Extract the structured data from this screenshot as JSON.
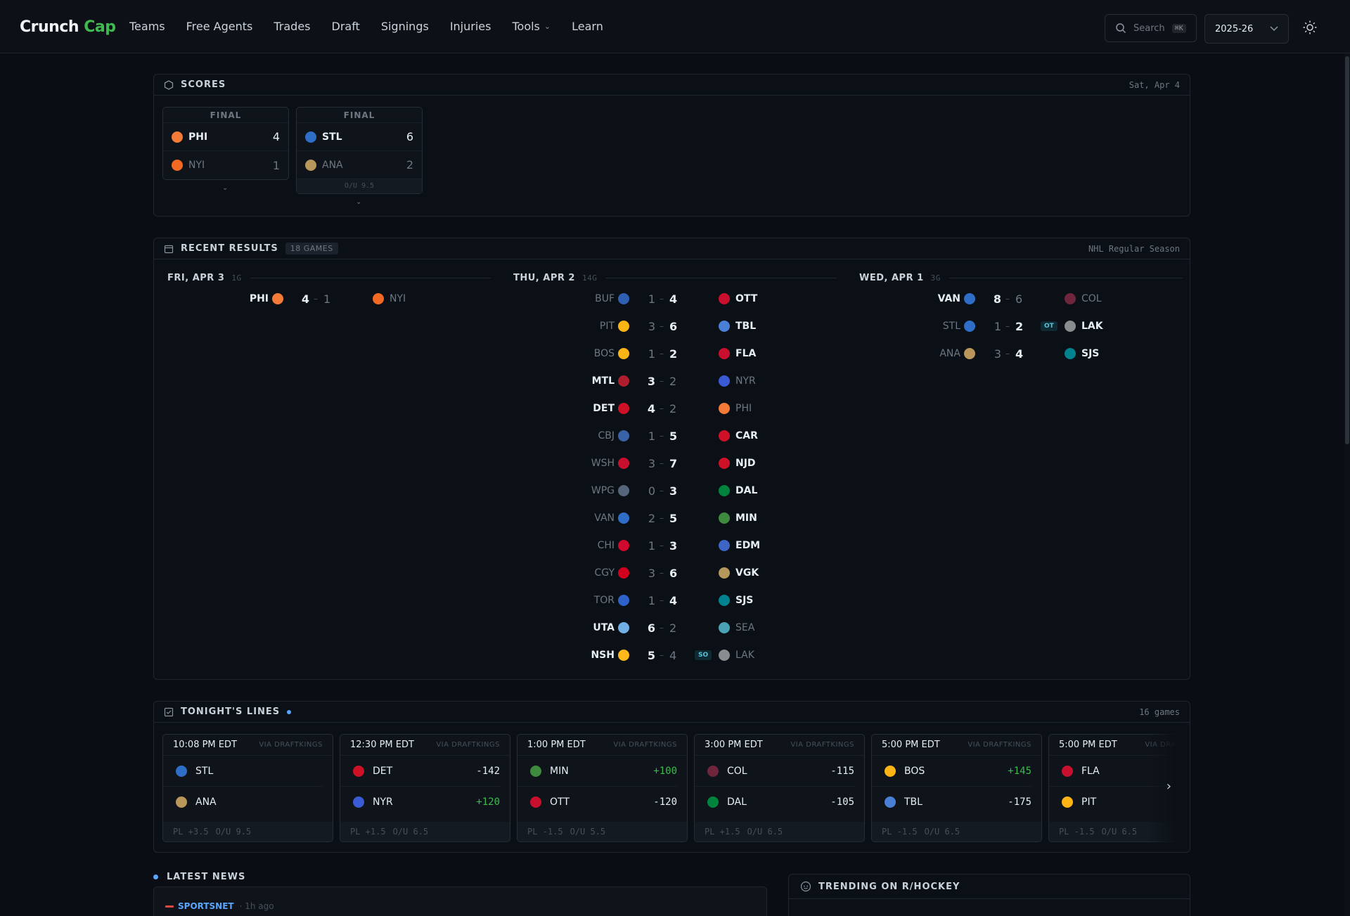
{
  "nav": {
    "logo_main": "Crunch",
    "logo_accent": "Cap",
    "links": [
      "Teams",
      "Free Agents",
      "Trades",
      "Draft",
      "Signings",
      "Injuries",
      "Tools",
      "Learn"
    ],
    "search_placeholder": "Search",
    "search_kbd": "⌘K",
    "season": "2025-26"
  },
  "colors": {
    "accent": "#3fb950",
    "link": "#58a6ff",
    "badge": "#58c4dc"
  },
  "scores": {
    "title": "SCORES",
    "date": "Sat, Apr 4",
    "cards": [
      {
        "status": "FINAL",
        "rows": [
          {
            "team": "PHI",
            "score": "4",
            "win": true
          },
          {
            "team": "NYI",
            "score": "1",
            "win": false
          }
        ],
        "ou": ""
      },
      {
        "status": "FINAL",
        "rows": [
          {
            "team": "STL",
            "score": "6",
            "win": true
          },
          {
            "team": "ANA",
            "score": "2",
            "win": false
          }
        ],
        "ou": "O/U 9.5"
      }
    ]
  },
  "recent": {
    "title": "RECENT RESULTS",
    "count": "18 GAMES",
    "season_label": "NHL Regular Season",
    "days": [
      {
        "label": "FRI, APR 3",
        "count": "1G",
        "games": [
          {
            "away": "PHI",
            "as": "4",
            "hs": "1",
            "home": "NYI",
            "tag": "",
            "aw": true
          }
        ]
      },
      {
        "label": "THU, APR 2",
        "count": "14G",
        "games": [
          {
            "away": "BUF",
            "as": "1",
            "hs": "4",
            "home": "OTT",
            "tag": "",
            "aw": false
          },
          {
            "away": "PIT",
            "as": "3",
            "hs": "6",
            "home": "TBL",
            "tag": "",
            "aw": false
          },
          {
            "away": "BOS",
            "as": "1",
            "hs": "2",
            "home": "FLA",
            "tag": "",
            "aw": false
          },
          {
            "away": "MTL",
            "as": "3",
            "hs": "2",
            "home": "NYR",
            "tag": "",
            "aw": true
          },
          {
            "away": "DET",
            "as": "4",
            "hs": "2",
            "home": "PHI",
            "tag": "",
            "aw": true
          },
          {
            "away": "CBJ",
            "as": "1",
            "hs": "5",
            "home": "CAR",
            "tag": "",
            "aw": false
          },
          {
            "away": "WSH",
            "as": "3",
            "hs": "7",
            "home": "NJD",
            "tag": "",
            "aw": false
          },
          {
            "away": "WPG",
            "as": "0",
            "hs": "3",
            "home": "DAL",
            "tag": "",
            "aw": false
          },
          {
            "away": "VAN",
            "as": "2",
            "hs": "5",
            "home": "MIN",
            "tag": "",
            "aw": false
          },
          {
            "away": "CHI",
            "as": "1",
            "hs": "3",
            "home": "EDM",
            "tag": "",
            "aw": false
          },
          {
            "away": "CGY",
            "as": "3",
            "hs": "6",
            "home": "VGK",
            "tag": "",
            "aw": false
          },
          {
            "away": "TOR",
            "as": "1",
            "hs": "4",
            "home": "SJS",
            "tag": "",
            "aw": false
          },
          {
            "away": "UTA",
            "as": "6",
            "hs": "2",
            "home": "SEA",
            "tag": "",
            "aw": true
          },
          {
            "away": "NSH",
            "as": "5",
            "hs": "4",
            "home": "LAK",
            "tag": "SO",
            "aw": true
          }
        ]
      },
      {
        "label": "WED, APR 1",
        "count": "3G",
        "games": [
          {
            "away": "VAN",
            "as": "8",
            "hs": "6",
            "home": "COL",
            "tag": "",
            "aw": true
          },
          {
            "away": "STL",
            "as": "1",
            "hs": "2",
            "home": "LAK",
            "tag": "OT",
            "aw": false
          },
          {
            "away": "ANA",
            "as": "3",
            "hs": "4",
            "home": "SJS",
            "tag": "",
            "aw": false
          }
        ]
      }
    ]
  },
  "lines": {
    "title": "TONIGHT'S LINES",
    "count": "16 games",
    "via": "VIA DRAFTKINGS",
    "games": [
      {
        "time": "10:08 PM EDT",
        "t1": "STL",
        "m1": "",
        "t2": "ANA",
        "m2": "",
        "pl": "PL +3.5",
        "ou": "O/U 9.5"
      },
      {
        "time": "12:30 PM EDT",
        "t1": "DET",
        "m1": "-142",
        "t2": "NYR",
        "m2": "+120",
        "pl": "PL +1.5",
        "ou": "O/U 6.5"
      },
      {
        "time": "1:00 PM EDT",
        "t1": "MIN",
        "m1": "+100",
        "t2": "OTT",
        "m2": "-120",
        "pl": "PL -1.5",
        "ou": "O/U 5.5"
      },
      {
        "time": "3:00 PM EDT",
        "t1": "COL",
        "m1": "-115",
        "t2": "DAL",
        "m2": "-105",
        "pl": "PL +1.5",
        "ou": "O/U 6.5"
      },
      {
        "time": "5:00 PM EDT",
        "t1": "BOS",
        "m1": "+145",
        "t2": "TBL",
        "m2": "-175",
        "pl": "PL -1.5",
        "ou": "O/U 6.5"
      },
      {
        "time": "5:00 PM EDT",
        "t1": "FLA",
        "m1": "",
        "t2": "PIT",
        "m2": "",
        "pl": "PL -1.5",
        "ou": "O/U 6.5"
      }
    ]
  },
  "news": {
    "title": "LATEST NEWS",
    "source": "SPORTSNET",
    "ago": "1h ago"
  },
  "trending": {
    "title": "TRENDING ON R/HOCKEY"
  },
  "team_colors": {
    "PHI": "#f47a38",
    "NYI": "#f26924",
    "STL": "#2f6ec7",
    "ANA": "#b9975b",
    "BUF": "#2e5fb3",
    "OTT": "#c8102e",
    "PIT": "#fcb514",
    "TBL": "#4a7fd6",
    "BOS": "#fcb514",
    "FLA": "#c8102e",
    "MTL": "#af1e2d",
    "NYR": "#3b5bd6",
    "DET": "#ce1126",
    "CBJ": "#3962a8",
    "CAR": "#ce1126",
    "WSH": "#c8102e",
    "NJD": "#ce1126",
    "WPG": "#55657a",
    "DAL": "#00843d",
    "VAN": "#2f6ec7",
    "MIN": "#3e8a3e",
    "CHI": "#cf0a2c",
    "EDM": "#3c65c4",
    "CGY": "#d2001c",
    "VGK": "#b4975a",
    "TOR": "#2e62c8",
    "SJS": "#00838f",
    "UTA": "#71afe5",
    "SEA": "#4aa3b5",
    "NSH": "#ffb81c",
    "LAK": "#8a8d8f",
    "COL": "#6f263d"
  }
}
